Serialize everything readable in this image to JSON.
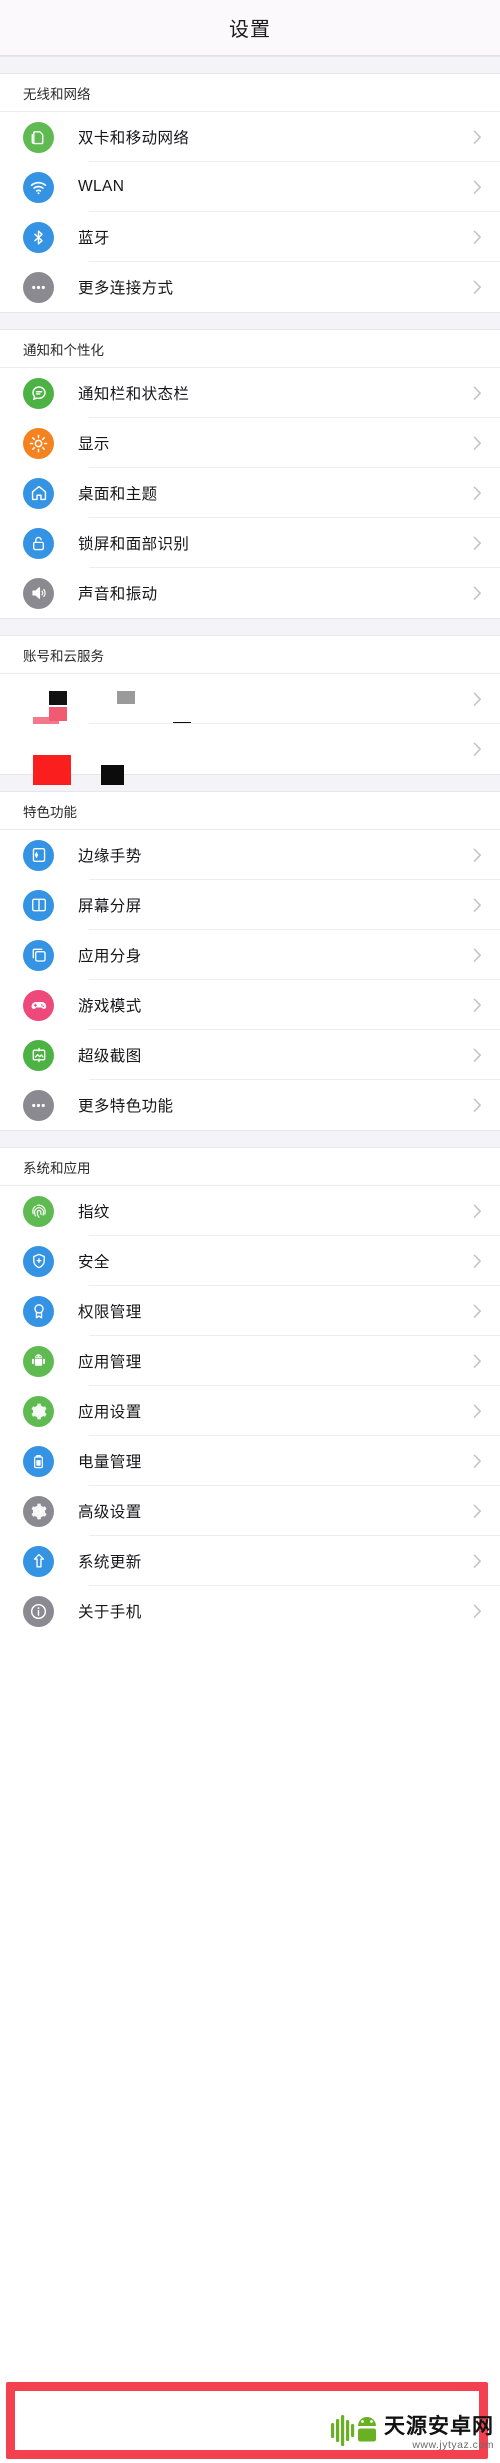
{
  "header": {
    "title": "设置"
  },
  "sections": [
    {
      "id": "wireless-network",
      "label": "无线和网络",
      "items": [
        {
          "label": "双卡和移动网络",
          "icon": "sim-card-icon",
          "color": "#5fbb51"
        },
        {
          "label": "WLAN",
          "icon": "wifi-icon",
          "color": "#3593e3"
        },
        {
          "label": "蓝牙",
          "icon": "bluetooth-icon",
          "color": "#3593e3"
        },
        {
          "label": "更多连接方式",
          "icon": "more-dots-icon",
          "color": "#8a8a90"
        }
      ]
    },
    {
      "id": "notification-personalization",
      "label": "通知和个性化",
      "items": [
        {
          "label": "通知栏和状态栏",
          "icon": "chat-bubble-icon",
          "color": "#4cb243"
        },
        {
          "label": "显示",
          "icon": "brightness-sun-icon",
          "color": "#f58220"
        },
        {
          "label": "桌面和主题",
          "icon": "home-icon",
          "color": "#3593e3"
        },
        {
          "label": "锁屏和面部识别",
          "icon": "lock-icon",
          "color": "#3593e3"
        },
        {
          "label": "声音和振动",
          "icon": "speaker-icon",
          "color": "#8a8a90"
        }
      ]
    },
    {
      "id": "account-cloud",
      "label": "账号和云服务",
      "items": [
        {
          "label": "",
          "icon": "redacted-icon",
          "color": "#ffffff",
          "redacted": true
        },
        {
          "label": "",
          "icon": "redacted-icon",
          "color": "#ffffff",
          "redacted": true
        }
      ]
    },
    {
      "id": "featured-functions",
      "label": "特色功能",
      "items": [
        {
          "label": "边缘手势",
          "icon": "edge-gesture-icon",
          "color": "#3593e3"
        },
        {
          "label": "屏幕分屏",
          "icon": "split-screen-icon",
          "color": "#3593e3"
        },
        {
          "label": "应用分身",
          "icon": "app-clone-icon",
          "color": "#3593e3"
        },
        {
          "label": "游戏模式",
          "icon": "gamepad-icon",
          "color": "#ed4a7b"
        },
        {
          "label": "超级截图",
          "icon": "screenshot-icon",
          "color": "#4cb243"
        },
        {
          "label": "更多特色功能",
          "icon": "more-dots-icon",
          "color": "#8a8a90"
        }
      ]
    },
    {
      "id": "system-apps",
      "label": "系统和应用",
      "items": [
        {
          "label": "指纹",
          "icon": "fingerprint-icon",
          "color": "#5fbb51"
        },
        {
          "label": "安全",
          "icon": "shield-icon",
          "color": "#3593e3"
        },
        {
          "label": "权限管理",
          "icon": "badge-icon",
          "color": "#3593e3"
        },
        {
          "label": "应用管理",
          "icon": "android-robot-icon",
          "color": "#5fbb51"
        },
        {
          "label": "应用设置",
          "icon": "gear-icon",
          "color": "#5fbb51"
        },
        {
          "label": "电量管理",
          "icon": "battery-icon",
          "color": "#3593e3"
        },
        {
          "label": "高级设置",
          "icon": "gear-icon",
          "color": "#8a8a90"
        },
        {
          "label": "系统更新",
          "icon": "update-arrow-icon",
          "color": "#3593e3"
        },
        {
          "label": "关于手机",
          "icon": "info-icon",
          "color": "#8a8a90",
          "highlighted": true
        }
      ]
    }
  ],
  "highlight": {
    "color": "#f4414f"
  },
  "watermark": {
    "title": "天源安卓网",
    "url": "www.jytyaz.com",
    "logo_color": "#6ab023"
  }
}
